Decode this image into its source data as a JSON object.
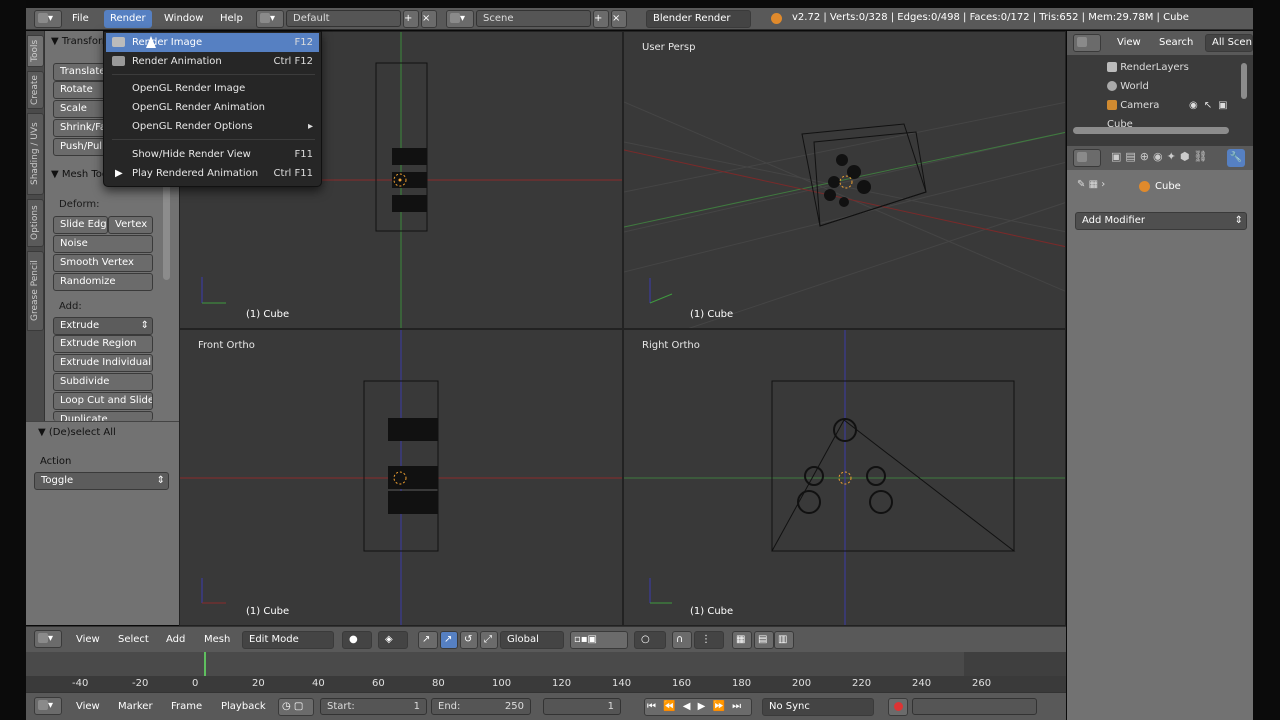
{
  "topbar": {
    "menus": [
      "File",
      "Render",
      "Window",
      "Help"
    ],
    "screen_layout": "Default",
    "scene": "Scene",
    "engine": "Blender Render",
    "stats": "v2.72 | Verts:0/328 | Edges:0/498 | Faces:0/172 | Tris:652 | Mem:29.78M | Cube"
  },
  "render_menu": {
    "items": [
      {
        "label": "Render Image",
        "shortcut": "F12"
      },
      {
        "label": "Render Animation",
        "shortcut": "Ctrl F12"
      },
      {
        "label": "OpenGL Render Image",
        "shortcut": ""
      },
      {
        "label": "OpenGL Render Animation",
        "shortcut": ""
      },
      {
        "label": "OpenGL Render Options",
        "shortcut": "▸"
      },
      {
        "label": "Show/Hide Render View",
        "shortcut": "F11"
      },
      {
        "label": "Play Rendered Animation",
        "shortcut": "Ctrl F11"
      }
    ]
  },
  "tool_tabs": [
    "Tools",
    "Create",
    "Shading / UVs",
    "Options",
    "Grease Pencil"
  ],
  "toolshelf": {
    "transform_header": "Transform",
    "transform": [
      "Translate",
      "Rotate",
      "Scale",
      "Shrink/Fatten",
      "Push/Pull"
    ],
    "mesh_header": "Mesh Tools",
    "deform_label": "Deform:",
    "slide_edge": "Slide Edge",
    "vertex": "Vertex",
    "deform": [
      "Noise",
      "Smooth Vertex",
      "Randomize"
    ],
    "add_label": "Add:",
    "extrude": "Extrude",
    "add": [
      "Extrude Region",
      "Extrude Individual",
      "Subdivide",
      "Loop Cut and Slide",
      "Duplicate"
    ]
  },
  "operator_panel": {
    "title": "(De)select All",
    "action_label": "Action",
    "action_value": "Toggle"
  },
  "viewports": {
    "top_name": "",
    "persp_name": "User Persp",
    "front_name": "Front Ortho",
    "right_name": "Right Ortho",
    "object_label": "(1) Cube"
  },
  "view3d_header": {
    "menus": [
      "View",
      "Select",
      "Add",
      "Mesh"
    ],
    "mode": "Edit Mode",
    "orientation": "Global"
  },
  "timeline": {
    "ticks": [
      "-40",
      "-20",
      "0",
      "20",
      "40",
      "60",
      "80",
      "100",
      "120",
      "140",
      "160",
      "180",
      "200",
      "220",
      "240",
      "260"
    ],
    "menus": [
      "View",
      "Marker",
      "Frame",
      "Playback"
    ],
    "start": "Start:",
    "start_value": "1",
    "end": "End:",
    "end_value": "250",
    "current": "1",
    "sync": "No Sync"
  },
  "outliner": {
    "menus": [
      "View",
      "Search"
    ],
    "scope": "All Scenes",
    "items": [
      "RenderLayers",
      "World",
      "Camera",
      "Cube"
    ]
  },
  "properties": {
    "object": "Cube",
    "add_modifier": "Add Modifier"
  },
  "colors": {
    "menu_highlight": "#5680c2",
    "x_axis": "#b03030",
    "y_axis": "#3f9a3f",
    "z_axis": "#3a3aa8"
  }
}
